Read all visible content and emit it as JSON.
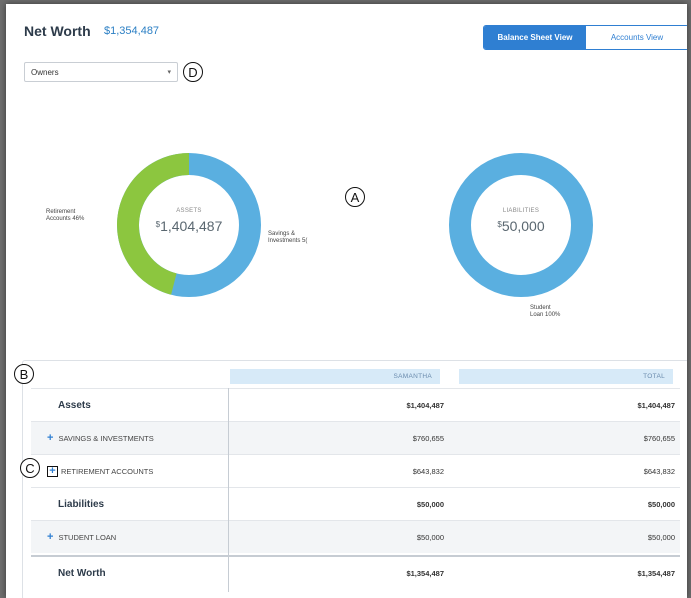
{
  "header": {
    "title": "Net Worth",
    "amount": "$1,354,487",
    "views": [
      "Balance Sheet View",
      "Accounts View"
    ],
    "active_view": "Balance Sheet View"
  },
  "owners_select": {
    "value": "Owners",
    "icon": "chevron-down-icon"
  },
  "markers": {
    "a": "A",
    "b": "B",
    "c": "C",
    "d": "D"
  },
  "assets_chart": {
    "center_label": "ASSETS",
    "currency": "$",
    "value": "1,404,487",
    "segments": [
      {
        "name": "Retirement Accounts",
        "label": "Retirement\nAccounts 46%",
        "percent": 46,
        "color": "#8cc63f"
      },
      {
        "name": "Savings & Investments",
        "label": "Savings &\nInvestments 5(",
        "percent": 54,
        "color": "#5aafe0"
      }
    ]
  },
  "liabilities_chart": {
    "center_label": "LIABILITIES",
    "currency": "$",
    "value": "50,000",
    "segments": [
      {
        "name": "Student Loan",
        "label": "Student\nLoan 100%",
        "percent": 100,
        "color": "#5aafe0"
      }
    ]
  },
  "table": {
    "columns": [
      "SAMANTHA",
      "TOTAL"
    ],
    "rows": [
      {
        "name": "Assets",
        "samantha": "$1,404,487",
        "total": "$1,404,487"
      },
      {
        "name": "SAVINGS & INVESTMENTS",
        "samantha": "$760,655",
        "total": "$760,655"
      },
      {
        "name": "RETIREMENT ACCOUNTS",
        "samantha": "$643,832",
        "total": "$643,832"
      },
      {
        "name": "Liabilities",
        "samantha": "$50,000",
        "total": "$50,000"
      },
      {
        "name": "STUDENT LOAN",
        "samantha": "$50,000",
        "total": "$50,000"
      },
      {
        "name": "Net Worth",
        "samantha": "$1,354,487",
        "total": "$1,354,487"
      }
    ]
  }
}
